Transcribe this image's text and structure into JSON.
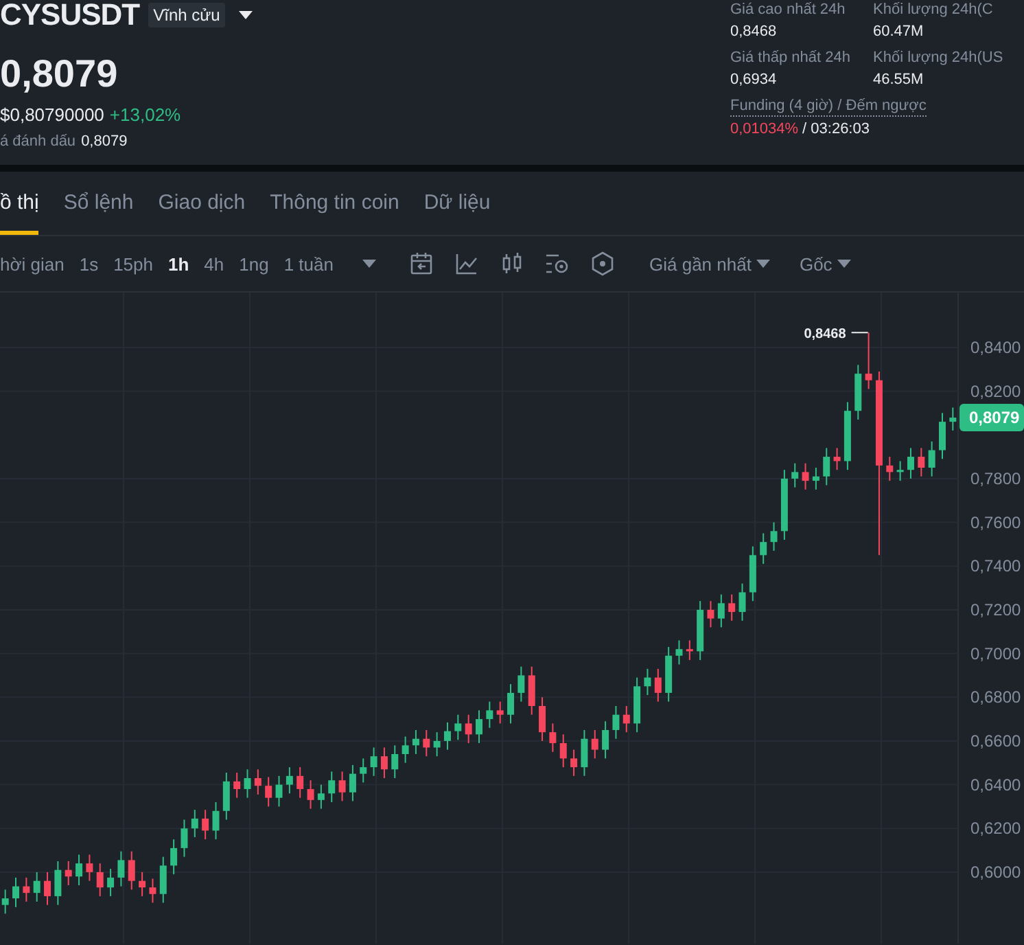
{
  "header": {
    "symbol": "CYSUSDT",
    "contract_type": "Vĩnh cửu",
    "last_price": "0,8079",
    "usd_price": "$0,80790000",
    "change": "+13,02%",
    "mark_price_label": "á đánh dấu",
    "mark_price": "0,8079"
  },
  "stats": [
    {
      "label": "Giá cao nhất 24h",
      "value": "0,8468"
    },
    {
      "label": "Khối lượng 24h(C",
      "value": "60.47M"
    },
    {
      "label": "Giá thấp nhất 24h",
      "value": "0,6934"
    },
    {
      "label": "Khối lượng 24h(US",
      "value": "46.55M"
    }
  ],
  "funding": {
    "label": "Funding (4 giờ) / Đếm ngược",
    "rate": "0,01034%",
    "countdown": "/ 03:26:03"
  },
  "tabs": [
    {
      "label": "ồ thị",
      "selected": true
    },
    {
      "label": "Sổ lệnh",
      "selected": false
    },
    {
      "label": "Giao dịch",
      "selected": false
    },
    {
      "label": "Thông tin coin",
      "selected": false
    },
    {
      "label": "Dữ liệu",
      "selected": false
    }
  ],
  "toolbar": {
    "time_label": "hời gian",
    "intervals": [
      {
        "label": "1s",
        "selected": false
      },
      {
        "label": "15ph",
        "selected": false
      },
      {
        "label": "1h",
        "selected": true
      },
      {
        "label": "4h",
        "selected": false
      },
      {
        "label": "1ng",
        "selected": false
      },
      {
        "label": "1 tuần",
        "selected": false
      }
    ],
    "price_type": "Giá gần nhất",
    "view": "Gốc"
  },
  "chart": {
    "high_label": "0,8468",
    "current_price": "0,8079",
    "chart_data": {
      "type": "candlestick",
      "grid": true,
      "ylim": [
        0.5673,
        0.8651
      ],
      "yticks": [
        {
          "value": 0.84,
          "label": "0,8400"
        },
        {
          "value": 0.82,
          "label": "0,8200"
        },
        {
          "value": 0.78,
          "label": "0,7800"
        },
        {
          "value": 0.76,
          "label": "0,7600"
        },
        {
          "value": 0.74,
          "label": "0,7400"
        },
        {
          "value": 0.72,
          "label": "0,7200"
        },
        {
          "value": 0.7,
          "label": "0,7000"
        },
        {
          "value": 0.68,
          "label": "0,6800"
        },
        {
          "value": 0.66,
          "label": "0,6600"
        },
        {
          "value": 0.64,
          "label": "0,6400"
        },
        {
          "value": 0.62,
          "label": "0,6200"
        },
        {
          "value": 0.6,
          "label": "0,6000"
        }
      ],
      "categories": [
        null,
        null,
        null,
        null,
        null,
        null,
        null,
        null,
        null,
        null,
        null,
        null,
        null,
        null,
        null,
        null,
        null,
        null,
        null,
        null,
        null,
        null,
        null,
        null,
        null,
        null,
        null,
        null,
        null,
        null,
        null,
        null,
        null,
        null,
        null,
        null,
        null,
        null,
        null,
        null,
        null,
        null,
        null,
        null,
        null,
        null,
        null,
        null,
        null,
        null,
        null,
        null,
        null,
        null,
        null,
        null,
        null,
        null,
        null,
        null,
        null,
        null,
        null,
        null,
        null,
        null,
        null,
        null,
        null,
        null,
        null,
        null,
        null,
        null,
        null,
        null,
        null,
        null,
        null,
        null,
        null,
        null,
        null,
        null,
        null,
        null,
        null,
        null,
        null,
        null,
        null
      ],
      "ohlc": [
        [
          0.585,
          0.592,
          0.581,
          0.588
        ],
        [
          0.588,
          0.5975,
          0.584,
          0.5935
        ],
        [
          0.5935,
          0.5975,
          0.5865,
          0.5905
        ],
        [
          0.5905,
          0.6,
          0.5865,
          0.596
        ],
        [
          0.596,
          0.6,
          0.585,
          0.589
        ],
        [
          0.589,
          0.605,
          0.585,
          0.601
        ],
        [
          0.601,
          0.605,
          0.594,
          0.598
        ],
        [
          0.598,
          0.608,
          0.594,
          0.604
        ],
        [
          0.604,
          0.608,
          0.596,
          0.6
        ],
        [
          0.6,
          0.604,
          0.589,
          0.593
        ],
        [
          0.593,
          0.6015,
          0.589,
          0.5975
        ],
        [
          0.5975,
          0.6095,
          0.5935,
          0.6055
        ],
        [
          0.6055,
          0.6095,
          0.592,
          0.596
        ],
        [
          0.596,
          0.6,
          0.589,
          0.593
        ],
        [
          0.593,
          0.597,
          0.586,
          0.59
        ],
        [
          0.59,
          0.607,
          0.586,
          0.603
        ],
        [
          0.603,
          0.615,
          0.599,
          0.611
        ],
        [
          0.611,
          0.624,
          0.607,
          0.62
        ],
        [
          0.62,
          0.6285,
          0.616,
          0.6245
        ],
        [
          0.6245,
          0.6285,
          0.615,
          0.619
        ],
        [
          0.619,
          0.632,
          0.615,
          0.628
        ],
        [
          0.628,
          0.6455,
          0.624,
          0.6415
        ],
        [
          0.6415,
          0.6455,
          0.634,
          0.638
        ],
        [
          0.638,
          0.647,
          0.634,
          0.643
        ],
        [
          0.643,
          0.647,
          0.6355,
          0.6395
        ],
        [
          0.6395,
          0.6435,
          0.63,
          0.634
        ],
        [
          0.634,
          0.644,
          0.63,
          0.64
        ],
        [
          0.64,
          0.648,
          0.636,
          0.644
        ],
        [
          0.644,
          0.648,
          0.634,
          0.638
        ],
        [
          0.638,
          0.642,
          0.629,
          0.633
        ],
        [
          0.633,
          0.64,
          0.629,
          0.636
        ],
        [
          0.636,
          0.646,
          0.632,
          0.642
        ],
        [
          0.642,
          0.646,
          0.6325,
          0.6365
        ],
        [
          0.6365,
          0.649,
          0.6325,
          0.645
        ],
        [
          0.645,
          0.652,
          0.641,
          0.648
        ],
        [
          0.648,
          0.657,
          0.644,
          0.653
        ],
        [
          0.653,
          0.657,
          0.643,
          0.647
        ],
        [
          0.647,
          0.658,
          0.643,
          0.654
        ],
        [
          0.654,
          0.662,
          0.65,
          0.658
        ],
        [
          0.658,
          0.665,
          0.654,
          0.661
        ],
        [
          0.661,
          0.665,
          0.653,
          0.657
        ],
        [
          0.657,
          0.664,
          0.653,
          0.66
        ],
        [
          0.66,
          0.6685,
          0.656,
          0.6645
        ],
        [
          0.6645,
          0.672,
          0.6605,
          0.668
        ],
        [
          0.668,
          0.672,
          0.659,
          0.663
        ],
        [
          0.663,
          0.674,
          0.659,
          0.67
        ],
        [
          0.67,
          0.678,
          0.666,
          0.674
        ],
        [
          0.674,
          0.678,
          0.668,
          0.672
        ],
        [
          0.672,
          0.686,
          0.668,
          0.682
        ],
        [
          0.682,
          0.694,
          0.678,
          0.69
        ],
        [
          0.69,
          0.694,
          0.672,
          0.676
        ],
        [
          0.676,
          0.68,
          0.66,
          0.664
        ],
        [
          0.664,
          0.668,
          0.655,
          0.659
        ],
        [
          0.659,
          0.663,
          0.648,
          0.652
        ],
        [
          0.652,
          0.656,
          0.644,
          0.648
        ],
        [
          0.648,
          0.665,
          0.644,
          0.661
        ],
        [
          0.661,
          0.665,
          0.652,
          0.656
        ],
        [
          0.656,
          0.669,
          0.652,
          0.665
        ],
        [
          0.665,
          0.676,
          0.661,
          0.672
        ],
        [
          0.672,
          0.676,
          0.664,
          0.668
        ],
        [
          0.668,
          0.689,
          0.664,
          0.685
        ],
        [
          0.685,
          0.693,
          0.681,
          0.689
        ],
        [
          0.689,
          0.693,
          0.678,
          0.682
        ],
        [
          0.682,
          0.703,
          0.678,
          0.699
        ],
        [
          0.699,
          0.706,
          0.695,
          0.702
        ],
        [
          0.702,
          0.706,
          0.697,
          0.701
        ],
        [
          0.701,
          0.724,
          0.697,
          0.72
        ],
        [
          0.72,
          0.724,
          0.712,
          0.716
        ],
        [
          0.716,
          0.727,
          0.712,
          0.723
        ],
        [
          0.723,
          0.727,
          0.715,
          0.719
        ],
        [
          0.719,
          0.732,
          0.715,
          0.728
        ],
        [
          0.728,
          0.749,
          0.724,
          0.745
        ],
        [
          0.745,
          0.755,
          0.741,
          0.751
        ],
        [
          0.751,
          0.76,
          0.747,
          0.756
        ],
        [
          0.756,
          0.784,
          0.752,
          0.78
        ],
        [
          0.78,
          0.787,
          0.776,
          0.783
        ],
        [
          0.783,
          0.787,
          0.775,
          0.779
        ],
        [
          0.779,
          0.785,
          0.775,
          0.781
        ],
        [
          0.781,
          0.794,
          0.777,
          0.79
        ],
        [
          0.79,
          0.794,
          0.784,
          0.788
        ],
        [
          0.788,
          0.815,
          0.784,
          0.811
        ],
        [
          0.811,
          0.832,
          0.807,
          0.828
        ],
        [
          0.828,
          0.8468,
          0.821,
          0.825
        ],
        [
          0.825,
          0.829,
          0.745,
          0.786
        ],
        [
          0.786,
          0.79,
          0.779,
          0.783
        ],
        [
          0.783,
          0.788,
          0.779,
          0.784
        ],
        [
          0.784,
          0.794,
          0.78,
          0.79
        ],
        [
          0.79,
          0.794,
          0.781,
          0.785
        ],
        [
          0.785,
          0.797,
          0.781,
          0.793
        ],
        [
          0.793,
          0.81,
          0.789,
          0.806
        ],
        [
          0.806,
          0.8125,
          0.802,
          0.8079
        ]
      ]
    }
  }
}
